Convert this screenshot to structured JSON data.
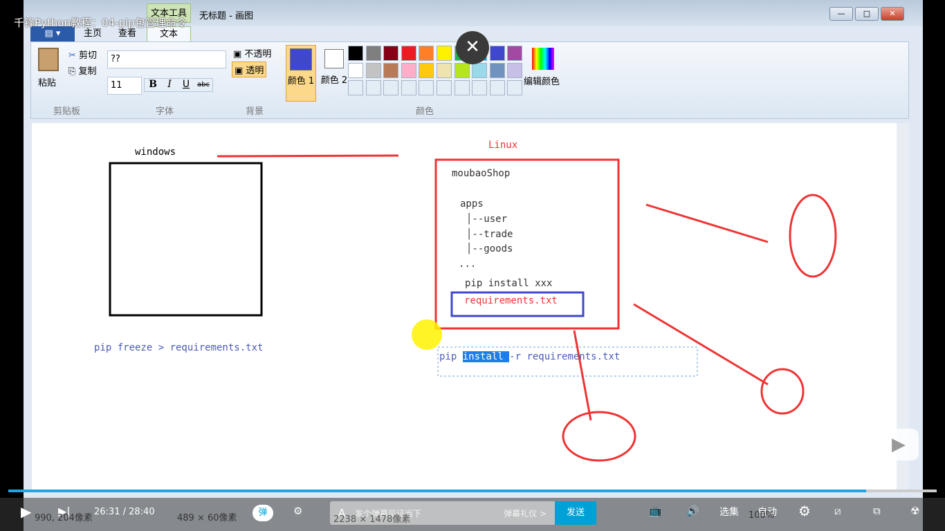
{
  "video": {
    "title": "千锋Python教程：04-pip包管理命令",
    "current_time": "26:31",
    "total_time": "28:40",
    "progress": 0.924
  },
  "paint": {
    "window_title": "无标题 - 画图",
    "context_tab": "文本工具",
    "tabs": [
      "主页",
      "查看",
      "文本"
    ],
    "clipboard": {
      "paste": "粘贴",
      "cut": "剪切",
      "copy": "复制",
      "group": "剪贴板"
    },
    "font": {
      "name": "??",
      "size": "11",
      "bold": "B",
      "italic": "I",
      "underline": "U",
      "strike": "abc",
      "group": "字体"
    },
    "background": {
      "opaque": "不透明",
      "transparent": "透明",
      "group": "背景"
    },
    "colors": {
      "color1": "颜色 1",
      "color2": "颜色 2",
      "edit": "编辑颜色",
      "group": "颜色",
      "color1_value": "#3f48cc",
      "palette_row1": [
        "#000000",
        "#7f7f7f",
        "#880015",
        "#ed1c24",
        "#ff7f27",
        "#fff200",
        "#22b14c",
        "#00a2e8",
        "#3f48cc",
        "#a349a4"
      ],
      "palette_row2": [
        "#ffffff",
        "#c3c3c3",
        "#b97a57",
        "#ffaec9",
        "#ffc90e",
        "#efe4b0",
        "#b5e61d",
        "#99d9ea",
        "#7092be",
        "#c8bfe7"
      ]
    },
    "status": {
      "cursor": "990, 204像素",
      "selection": "489 × 60像素",
      "canvas": "2238 × 1478像素",
      "zoom": "100%"
    }
  },
  "canvas": {
    "windows_label": "windows",
    "linux_label": "Linux",
    "project": "moubaoShop",
    "apps": "apps",
    "tree": [
      "│--user",
      "│--trade",
      "│--goods"
    ],
    "ellipsis": "...",
    "pip_install": "pip install xxx",
    "requirements": "requirements.txt",
    "freeze": "pip freeze > requirements.txt",
    "install_prefix": "pip ",
    "install_sel": "install ",
    "install_rest": "-r requirements.txt"
  },
  "player": {
    "danmaku_toggle": "弹",
    "danmaku_placeholder": "发个弹幕见证当下",
    "etiquette": "弹幕礼仪 >",
    "send": "发送",
    "episodes": "选集",
    "quality": "自动"
  }
}
